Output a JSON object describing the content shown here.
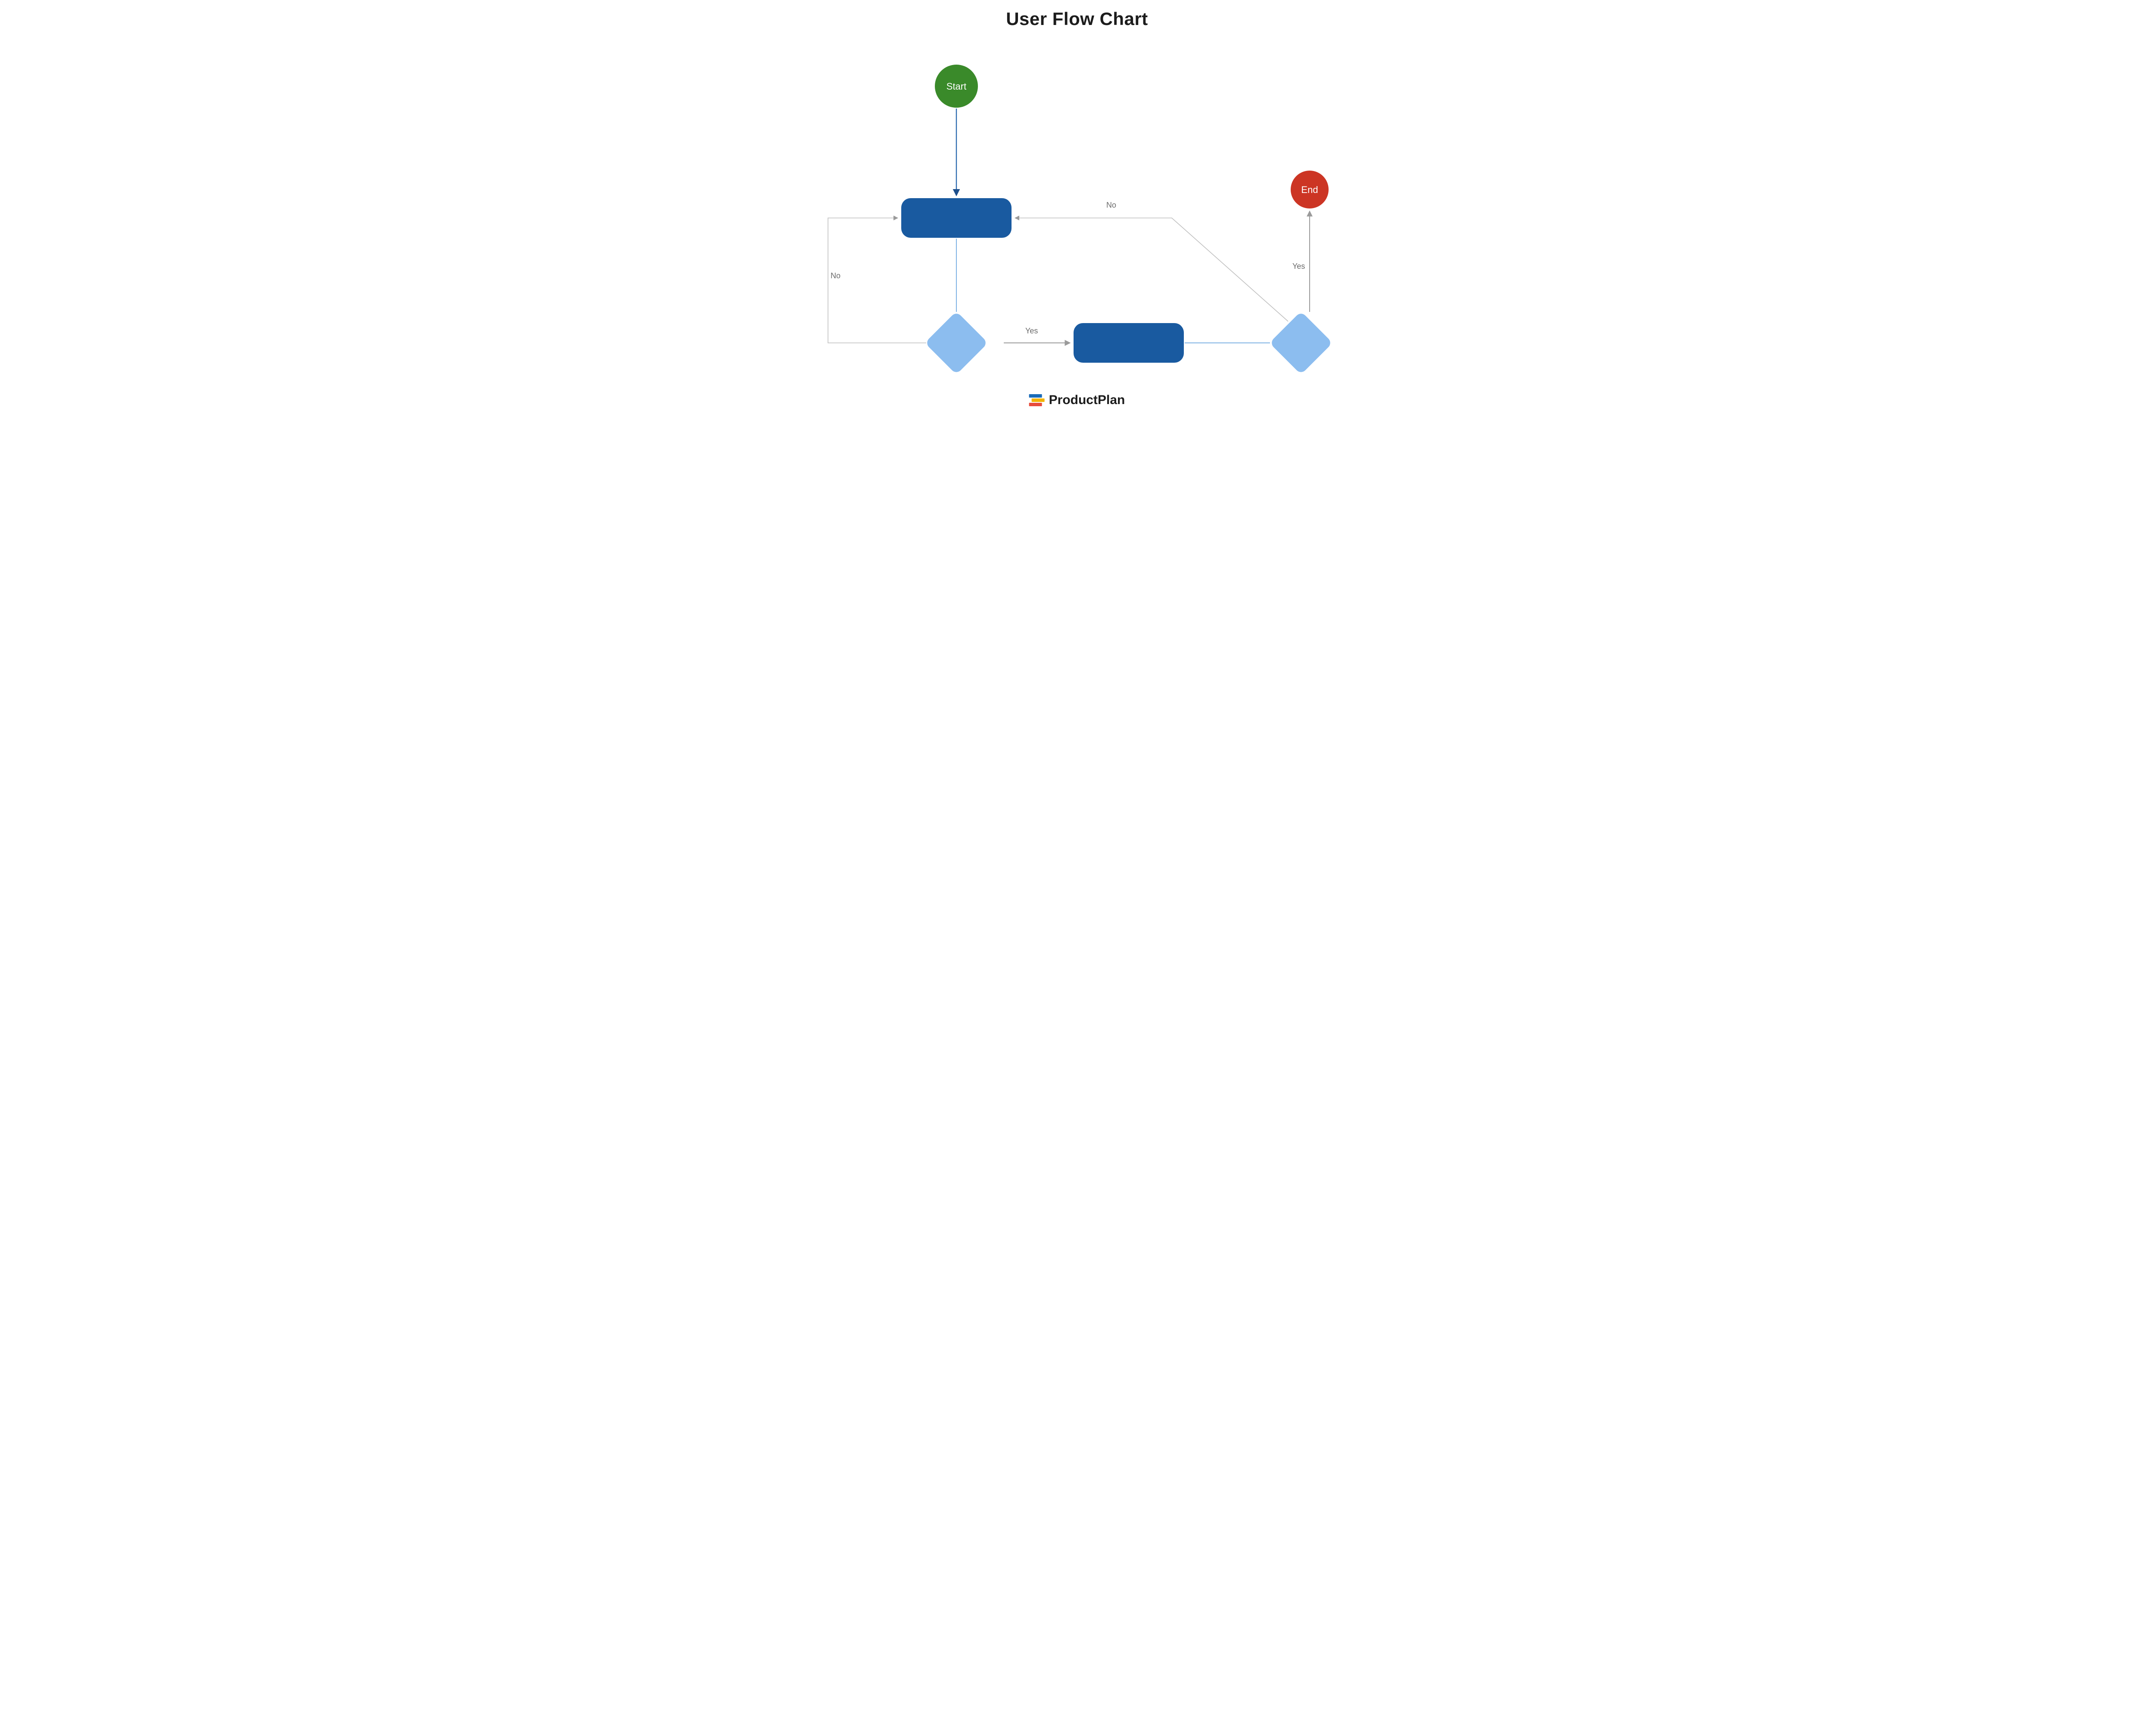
{
  "title": "User Flow Chart",
  "logo_text": "ProductPlan",
  "nodes": {
    "start": {
      "label": "Start",
      "shape": "circle",
      "color": "#3a8a2a"
    },
    "process_a": {
      "label": "",
      "shape": "process",
      "color": "#195aa0"
    },
    "decision_a": {
      "label": "",
      "shape": "decision",
      "color": "#8cbdef"
    },
    "process_b": {
      "label": "",
      "shape": "process",
      "color": "#195aa0"
    },
    "decision_b": {
      "label": "",
      "shape": "decision",
      "color": "#8cbdef"
    },
    "end": {
      "label": "End",
      "shape": "circle",
      "color": "#cc3524"
    }
  },
  "edges": [
    {
      "from": "start",
      "to": "process_a",
      "label": ""
    },
    {
      "from": "process_a",
      "to": "decision_a",
      "label": ""
    },
    {
      "from": "decision_a",
      "to": "process_b",
      "label": "Yes"
    },
    {
      "from": "decision_a",
      "to": "process_a",
      "label": "No"
    },
    {
      "from": "process_b",
      "to": "decision_b",
      "label": ""
    },
    {
      "from": "decision_b",
      "to": "end",
      "label": "Yes"
    },
    {
      "from": "decision_b",
      "to": "process_a",
      "label": "No"
    }
  ],
  "colors": {
    "arrow_dark": "#1d4f8c",
    "arrow_light": "#a7a7a7",
    "circle_green": "#3a8a2a",
    "circle_red": "#cc3524",
    "process_blue": "#195aa0",
    "decision_blue": "#8cbdef"
  }
}
